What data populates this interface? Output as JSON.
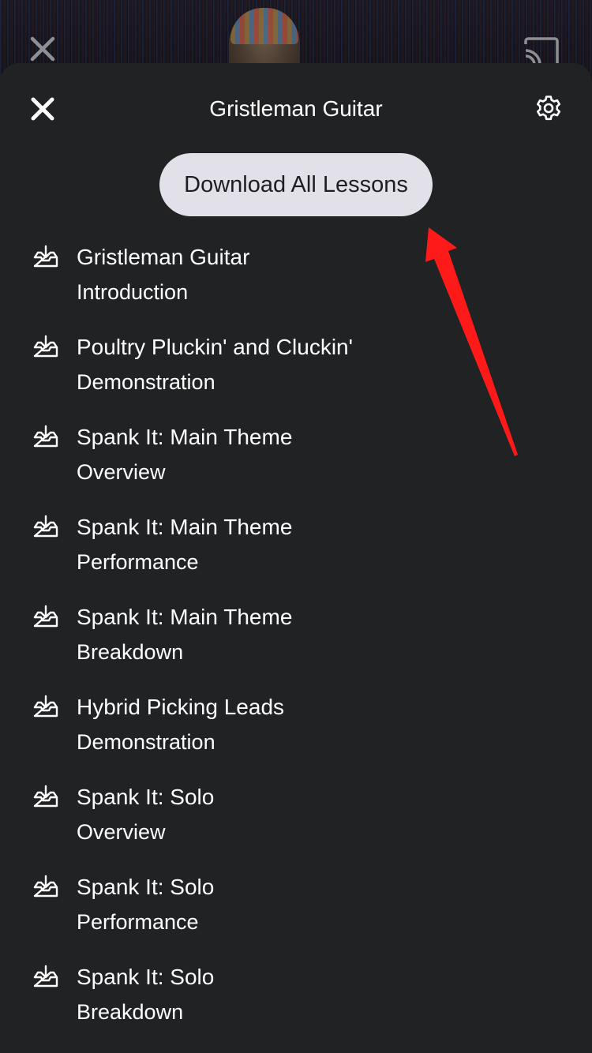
{
  "player": {
    "close_icon": "close-icon",
    "cast_icon": "cast-icon"
  },
  "sheet": {
    "title": "Gristleman Guitar",
    "close_icon": "close-icon",
    "settings_icon": "gear-icon",
    "download_all_label": "Download All Lessons",
    "background_color": "#202224",
    "button_color": "#e2e0e8"
  },
  "lessons": [
    {
      "title": "Gristleman Guitar",
      "subtitle": "Introduction",
      "icon": "download-icon"
    },
    {
      "title": "Poultry Pluckin' and Cluckin'",
      "subtitle": "Demonstration",
      "icon": "download-icon"
    },
    {
      "title": "Spank It: Main Theme",
      "subtitle": "Overview",
      "icon": "download-icon"
    },
    {
      "title": "Spank It: Main Theme",
      "subtitle": "Performance",
      "icon": "download-icon"
    },
    {
      "title": "Spank It: Main Theme",
      "subtitle": "Breakdown",
      "icon": "download-icon"
    },
    {
      "title": "Hybrid Picking Leads",
      "subtitle": "Demonstration",
      "icon": "download-icon"
    },
    {
      "title": "Spank It: Solo",
      "subtitle": "Overview",
      "icon": "download-icon"
    },
    {
      "title": "Spank It: Solo",
      "subtitle": "Performance",
      "icon": "download-icon"
    },
    {
      "title": "Spank It: Solo",
      "subtitle": "Breakdown",
      "icon": "download-icon"
    }
  ],
  "annotation": {
    "arrow_color": "#ff1a1a"
  }
}
